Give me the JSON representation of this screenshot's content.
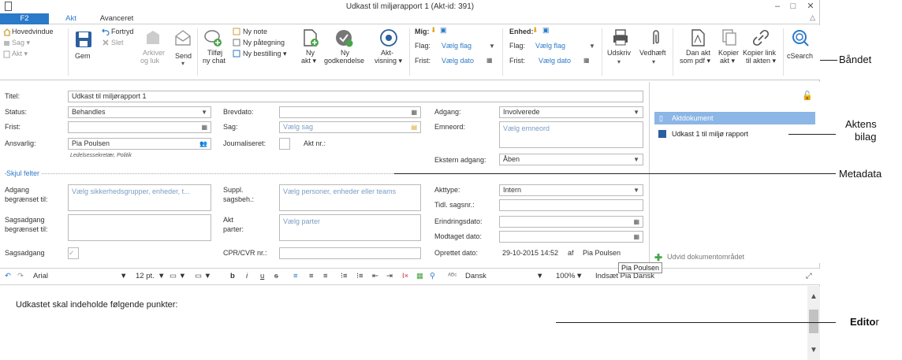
{
  "window": {
    "title": "Udkast til miljørapport 1 (Akt-id: 391)",
    "min": "–",
    "max": "□",
    "close": "✕"
  },
  "tabs": {
    "f2": "F2",
    "akt": "Akt",
    "advanced": "Avanceret",
    "collapse": "△"
  },
  "ribbon": {
    "hovedvindue": "Hovedvindue",
    "sag": "Sag ▾",
    "akt": "Akt ▾",
    "gem": "Gem",
    "fortryd": "Fortryd",
    "slet": "Slet",
    "arkiver1": "Arkiver",
    "arkiver2": "og luk",
    "send": "Send",
    "tilfoj1": "Tilføj",
    "tilfoj2": "ny chat",
    "nynote": "Ny note",
    "nypategning": "Ny påtegning",
    "nybestilling": "Ny bestilling ▾",
    "nyakt1": "Ny",
    "nyakt2": "akt ▾",
    "nygodk1": "Ny",
    "nygodk2": "godkendelse",
    "aktvisning1": "Akt-",
    "aktvisning2": "visning ▾",
    "mig": "Mig:",
    "enhed": "Enhed:",
    "flag": "Flag:",
    "frist": "Frist:",
    "vaelgflag": "Vælg flag",
    "vaelgdato": "Vælg dato",
    "udskriv": "Udskriv",
    "vedhaeft": "Vedhæft",
    "danakt1": "Dan akt",
    "danakt2": "som pdf ▾",
    "kopier1": "Kopier",
    "kopier2": "akt ▾",
    "kopierlink1": "Kopier link",
    "kopierlink2": "til akten ▾",
    "csearch": "cSearch"
  },
  "meta": {
    "titel_label": "Titel:",
    "titel": "Udkast til miljørapport 1",
    "status_label": "Status:",
    "status": "Behandles",
    "frist_label": "Frist:",
    "ansvarlig_label": "Ansvarlig:",
    "ansvarlig": "Pia Poulsen",
    "ansvarlig_sub": "Ledelsessekretær, Politik",
    "brevdato_label": "Brevdato:",
    "sag_label": "Sag:",
    "sag_ph": "Vælg sag",
    "journaliseret_label": "Journaliseret:",
    "aktnr_label": "Akt nr.:",
    "adgang_label": "Adgang:",
    "adgang": "Involverede",
    "emneord_label": "Emneord:",
    "emneord_ph": "Vælg emneord",
    "ekstern_label": "Ekstern adgang:",
    "ekstern": "Åben",
    "skjul": "Skjul felter",
    "adgang_begr_label1": "Adgang",
    "adgang_begr_label2": "begrænset til:",
    "adgang_begr_ph": "Vælg sikkerhedsgrupper, enheder, t...",
    "sagsadgang_begr1": "Sagsadgang",
    "sagsadgang_begr2": "begrænset til:",
    "sagsadgang_label": "Sagsadgang",
    "suppl1": "Suppl.",
    "suppl2": "sagsbeh.:",
    "suppl_ph": "Vælg personer, enheder eller teams",
    "akt_parter1": "Akt",
    "akt_parter2": "parter:",
    "parter_ph": "Vælg parter",
    "cpr_label": "CPR/CVR nr.:",
    "akttype_label": "Akttype:",
    "akttype": "Intern",
    "tidl_label": "Tidl. sagsnr.:",
    "erindring_label": "Erindringsdato:",
    "modtaget_label": "Modtaget dato:",
    "oprettet_label": "Oprettet dato:",
    "oprettet": "29-10-2015 14:52",
    "af": "af",
    "oprettet_af": "Pia Poulsen"
  },
  "side": {
    "header": "Aktdokument",
    "item": "Udkast 1 til miljø rapport",
    "udvid": "Udvid dokumentområdet"
  },
  "toolbar": {
    "font": "Arial",
    "size": "12 pt.",
    "lang": "Dansk",
    "zoom": "100%",
    "insert": "Indsæt Pia Dansk"
  },
  "tooltip": "Pia Poulsen",
  "editor": {
    "text": "Udkastet skal indeholde følgende punkter:"
  },
  "annotations": {
    "ribbon": "Båndet",
    "bilag1": "Aktens",
    "bilag2": "bilag",
    "metadata": "Metadata",
    "editor_bold": "Edito",
    "editor_tail": "r"
  }
}
